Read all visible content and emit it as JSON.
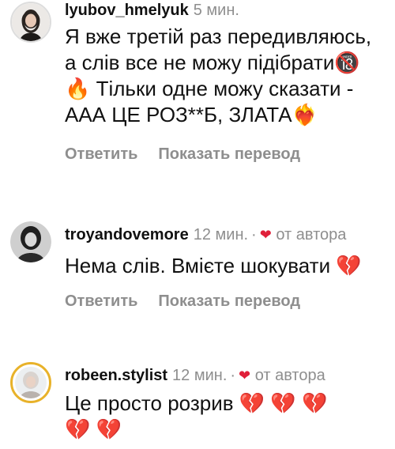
{
  "comments": [
    {
      "username": "lyubov_hmelyuk",
      "time": "5 мин.",
      "text": "Я вже третій раз передивляюсь, а слів все не можу підібрати🔞 🔥 Тільки одне можу сказати - ААА ЦЕ РОЗ**Б, ЗЛАТА❤️‍🔥",
      "reply_label": "Ответить",
      "translate_label": "Показать перевод"
    },
    {
      "username": "troyandovemore",
      "time": "12 мин.",
      "dot": "·",
      "heart": "❤",
      "liked_by_author": "от автора",
      "text": "Нема слів. Вмієте шокувати 💔",
      "reply_label": "Ответить",
      "translate_label": "Показать перевод"
    },
    {
      "username": "robeen.stylist",
      "time": "12 мин.",
      "dot": "·",
      "heart": "❤",
      "liked_by_author": "от автора",
      "text": "Це просто розрив 💔 💔 💔 💔 💔"
    }
  ],
  "colors": {
    "secondary_text": "#8e8e8e",
    "heart": "#e0203a",
    "story_ring": "#e8b22a"
  }
}
